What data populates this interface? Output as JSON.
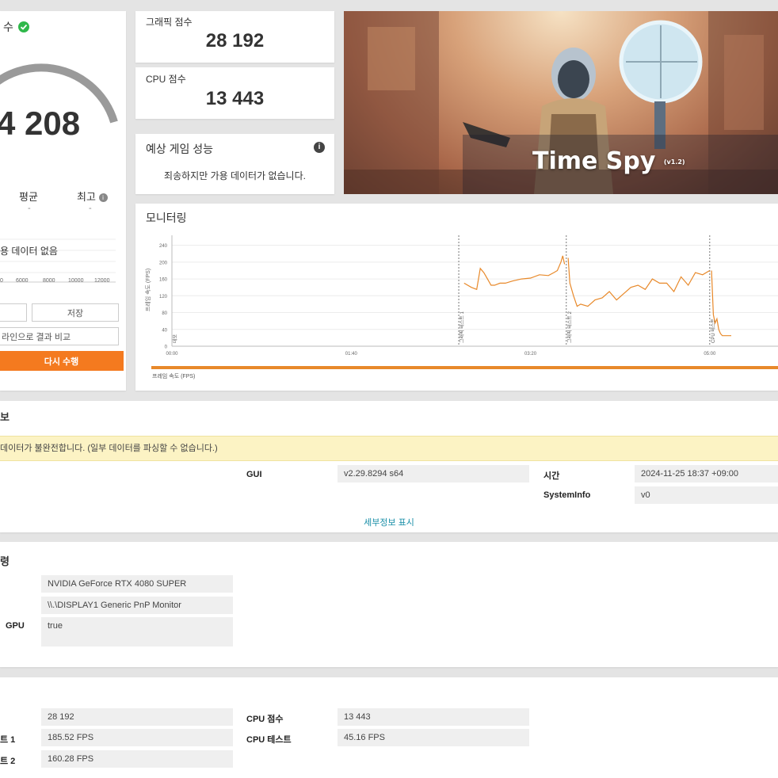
{
  "score_panel": {
    "title_partial": "수",
    "score_partial": "4 208",
    "avg_label": "평균",
    "avg_value": "-",
    "max_label": "최고",
    "max_value": "-",
    "no_data_partial": "용 데이터 없음",
    "axis_ticks": [
      "0",
      "6000",
      "8000",
      "10000",
      "12000"
    ],
    "save_label": "저장",
    "compare_online_partial": "라인으로 결과 비교",
    "rerun_label": "다시 수행",
    "accent": "#f47a1f",
    "check_color": "#2fb84a"
  },
  "graphics_score": {
    "label": "그래픽 점수",
    "value": "28 192"
  },
  "cpu_score": {
    "label": "CPU 점수",
    "value": "13 443"
  },
  "game_perf": {
    "title": "예상 게임 성능",
    "message": "죄송하지만 가용 데이터가 없습니다."
  },
  "banner": {
    "title": "Time Spy",
    "version": "(v1.2)"
  },
  "monitoring": {
    "title": "모니터링",
    "y_axis_label": "프레임 속도 (FPS)",
    "y_ticks": [
      "0",
      "40",
      "80",
      "120",
      "160",
      "200",
      "240"
    ],
    "x_ticks": [
      "00:00",
      "01:40",
      "03:20",
      "05:00"
    ],
    "phase_labels": [
      "데모",
      "그래픽 테스트 1",
      "그래픽 테스트 2",
      "CPU 테스트"
    ],
    "legend_label": "프레임 속도 (FPS)",
    "line_color": "#e8892a"
  },
  "chart_data": {
    "type": "line",
    "xlabel": "",
    "ylabel": "프레임 속도 (FPS)",
    "ylim": [
      0,
      260
    ],
    "x_ticks": [
      "00:00",
      "01:40",
      "03:20",
      "05:00"
    ],
    "series": [
      {
        "name": "프레임 속도 (FPS)",
        "segments": [
          {
            "x": [
              163,
              167,
              170,
              172,
              174,
              176,
              178,
              180,
              183,
              186,
              190,
              195,
              200,
              205,
              210,
              213,
              215,
              217,
              218,
              219
            ],
            "y": [
              150,
              140,
              135,
              185,
              175,
              160,
              145,
              145,
              150,
              150,
              155,
              160,
              162,
              170,
              168,
              175,
              180,
              200,
              215,
              195
            ]
          },
          {
            "x": [
              221,
              222,
              224,
              226,
              228,
              232,
              236,
              240,
              244,
              248,
              252,
              256,
              260,
              264,
              268,
              272,
              276,
              280,
              284,
              288,
              292,
              296,
              300
            ],
            "y": [
              210,
              150,
              120,
              95,
              100,
              95,
              110,
              115,
              130,
              110,
              125,
              140,
              145,
              135,
              160,
              150,
              150,
              130,
              165,
              145,
              175,
              170,
              180
            ]
          },
          {
            "x": [
              301,
              302,
              303,
              304,
              305,
              306,
              307,
              309,
              312
            ],
            "y": [
              180,
              75,
              55,
              65,
              40,
              30,
              25,
              25,
              25
            ]
          }
        ]
      }
    ]
  },
  "info": {
    "warning": "데이터가 불완전합니다. (일부 데이터를 파싱할 수 없습니다.)",
    "partial_title": "보",
    "gui_label": "GUI",
    "gui_value": "v2.29.8294 s64",
    "time_label": "시간",
    "time_value": "2024-11-25 18:37 +09:00",
    "sysinfo_label": "SystemInfo",
    "sysinfo_value": "v0",
    "details_link": "세부정보 표시",
    "warning_bg": "#fcf3c4",
    "link_color": "#1a8fa8"
  },
  "monitor_section": {
    "partial_title": "령",
    "gpu_value": "NVIDIA GeForce RTX 4080 SUPER",
    "display_value": "\\\\.\\DISPLAY1 Generic PnP Monitor",
    "gpu_label_partial": "GPU",
    "gpu_flag_value": "true"
  },
  "results": {
    "graphics_score_value": "28 192",
    "test1_label_partial": "트 1",
    "test1_value": "185.52 FPS",
    "test2_label_partial": "트 2",
    "test2_value": "160.28 FPS",
    "cpu_score_label": "CPU 점수",
    "cpu_score_value": "13 443",
    "cpu_test_label": "CPU 테스트",
    "cpu_test_value": "45.16 FPS"
  }
}
